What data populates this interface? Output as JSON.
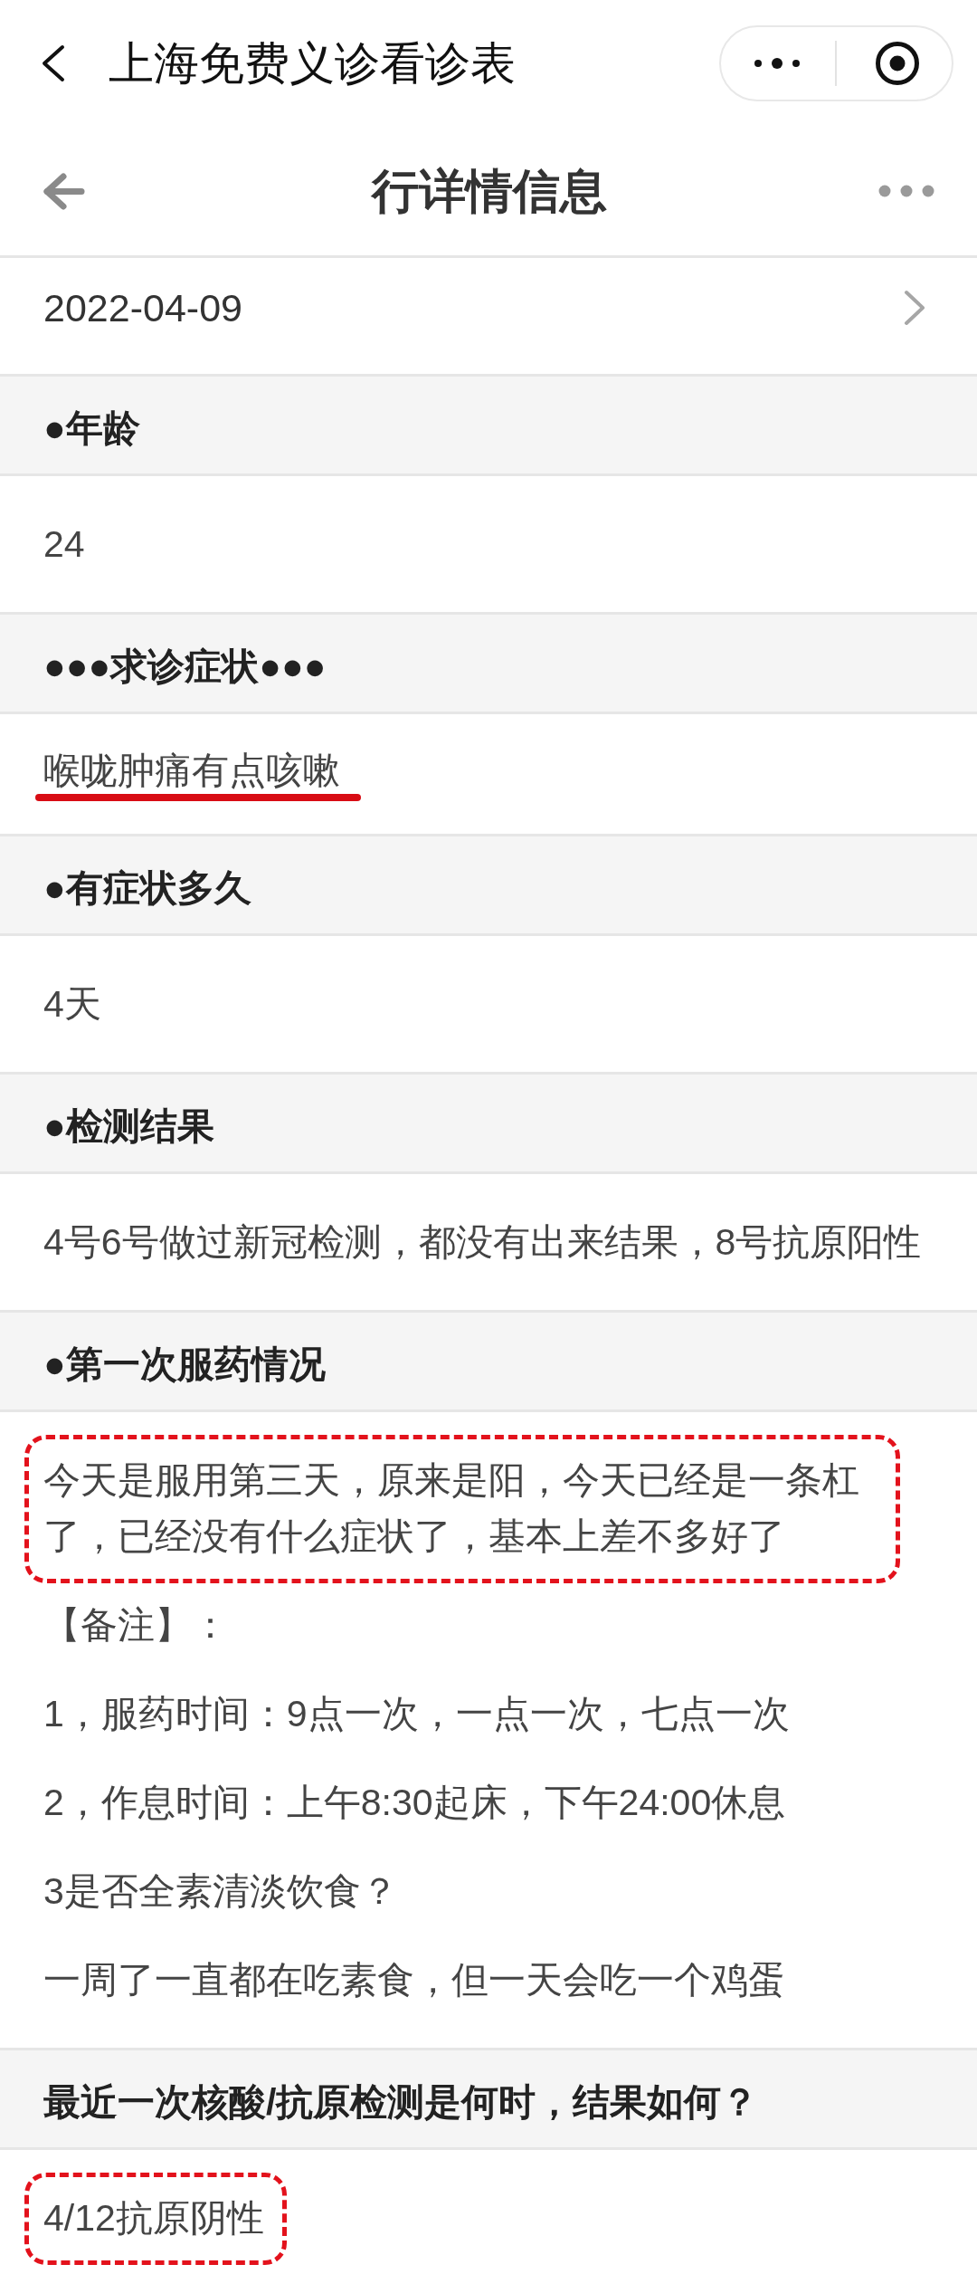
{
  "mini_program_bar": {
    "title": "上海免费义诊看诊表"
  },
  "page_header": {
    "title": "行详情信息"
  },
  "date_row": {
    "value": "2022-04-09"
  },
  "fields": [
    {
      "label": "●年龄",
      "paragraphs": [
        {
          "text": "24",
          "underlined": false,
          "boxed": false
        }
      ]
    },
    {
      "label": "●●●求诊症状●●●",
      "paragraphs": [
        {
          "text": "喉咙肿痛有点咳嗽",
          "underlined": true,
          "boxed": false
        }
      ]
    },
    {
      "label": "●有症状多久",
      "paragraphs": [
        {
          "text": "4天",
          "underlined": false,
          "boxed": false
        }
      ]
    },
    {
      "label": "●检测结果",
      "paragraphs": [
        {
          "text": "4号6号做过新冠检测，都没有出来结果，8号抗原阳性",
          "underlined": false,
          "boxed": false
        }
      ]
    },
    {
      "label": "●第一次服药情况",
      "paragraphs": [
        {
          "text": "今天是服用第三天，原来是阳，今天已经是一条杠了，已经没有什么症状了，基本上差不多好了",
          "underlined": false,
          "boxed": true
        },
        {
          "text": "【备注】：",
          "underlined": false,
          "boxed": false
        },
        {
          "text": "1，服药时间：9点一次，一点一次，七点一次",
          "underlined": false,
          "boxed": false
        },
        {
          "text": "2，作息时间：上午8:30起床，下午24:00休息",
          "underlined": false,
          "boxed": false
        },
        {
          "text": "3是否全素清淡饮食？",
          "underlined": false,
          "boxed": false
        },
        {
          "text": "一周了一直都在吃素食，但一天会吃一个鸡蛋",
          "underlined": false,
          "boxed": false
        }
      ]
    },
    {
      "label": "最近一次核酸/抗原检测是何时，结果如何？",
      "paragraphs": [
        {
          "text": "4/12抗原阴性",
          "underlined": false,
          "boxed": true
        }
      ]
    }
  ]
}
